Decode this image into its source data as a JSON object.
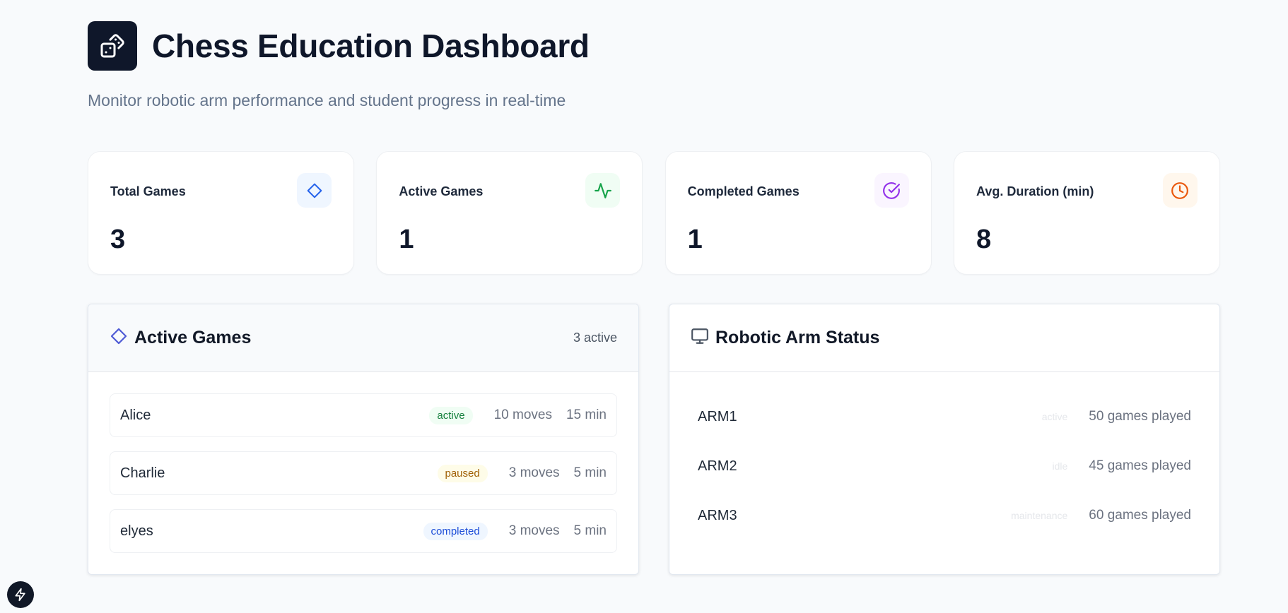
{
  "header": {
    "title": "Chess Education Dashboard",
    "subtitle": "Monitor robotic arm performance and student progress in real-time",
    "logo_icon": "dice-icon"
  },
  "stats": [
    {
      "label": "Total Games",
      "value": "3",
      "icon": "diamond-icon",
      "color": "#2563eb",
      "bg": "#eff6ff"
    },
    {
      "label": "Active Games",
      "value": "1",
      "icon": "activity-icon",
      "color": "#16a34a",
      "bg": "#f0fdf4"
    },
    {
      "label": "Completed Games",
      "value": "1",
      "icon": "check-circle-icon",
      "color": "#9333ea",
      "bg": "#faf5ff"
    },
    {
      "label": "Avg. Duration (min)",
      "value": "8",
      "icon": "clock-icon",
      "color": "#ea580c",
      "bg": "#fff7ed"
    }
  ],
  "active_games": {
    "title": "Active Games",
    "count": "3 active",
    "rows": [
      {
        "name": "Alice",
        "status": "active",
        "moves": "10 moves",
        "duration": "15 min"
      },
      {
        "name": "Charlie",
        "status": "paused",
        "moves": "3 moves",
        "duration": "5 min"
      },
      {
        "name": "elyes",
        "status": "completed",
        "moves": "3 moves",
        "duration": "5 min"
      }
    ]
  },
  "robotic_arms": {
    "title": "Robotic Arm Status",
    "rows": [
      {
        "name": "ARM1",
        "status": "active",
        "games": "50 games played"
      },
      {
        "name": "ARM2",
        "status": "idle",
        "games": "45 games played"
      },
      {
        "name": "ARM3",
        "status": "maintenance",
        "games": "60 games played"
      }
    ]
  },
  "colors": {
    "accent_dark": "#0f172a",
    "status_active": "#15803d",
    "status_paused": "#a16207",
    "status_completed": "#1d4ed8"
  }
}
